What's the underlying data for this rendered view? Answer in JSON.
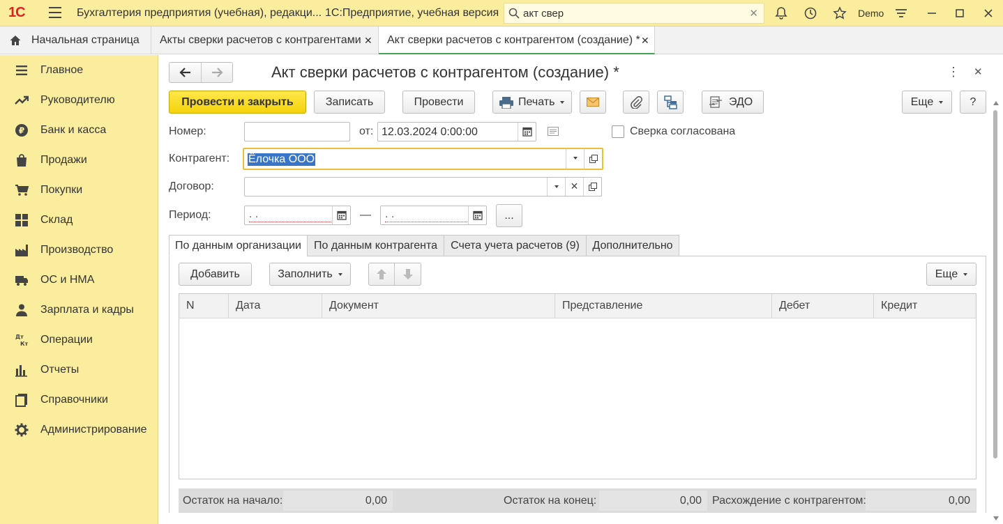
{
  "titlebar": {
    "logo": "1С",
    "app_title": "Бухгалтерия предприятия (учебная), редакци...",
    "platform": "1С:Предприятие, учебная версия",
    "search_value": "акт свер",
    "user": "Demo"
  },
  "tabs": [
    {
      "label": "Начальная страница"
    },
    {
      "label": "Акты сверки расчетов с контрагентами"
    },
    {
      "label": "Акт сверки расчетов с контрагентом (создание) *"
    }
  ],
  "sidebar": {
    "items": [
      {
        "label": "Главное",
        "icon": "menu-icon"
      },
      {
        "label": "Руководителю",
        "icon": "trend-icon"
      },
      {
        "label": "Банк и касса",
        "icon": "ruble-icon"
      },
      {
        "label": "Продажи",
        "icon": "bag-icon"
      },
      {
        "label": "Покупки",
        "icon": "cart-icon"
      },
      {
        "label": "Склад",
        "icon": "grid-icon"
      },
      {
        "label": "Производство",
        "icon": "factory-icon"
      },
      {
        "label": "ОС и НМА",
        "icon": "truck-icon"
      },
      {
        "label": "Зарплата и кадры",
        "icon": "person-icon"
      },
      {
        "label": "Операции",
        "icon": "dt-kt-icon"
      },
      {
        "label": "Отчеты",
        "icon": "bar-chart-icon"
      },
      {
        "label": "Справочники",
        "icon": "book-icon"
      },
      {
        "label": "Администрирование",
        "icon": "gear-icon"
      }
    ]
  },
  "form": {
    "title": "Акт сверки расчетов с контрагентом (создание) *",
    "toolbar": {
      "post_close": "Провести и закрыть",
      "save": "Записать",
      "post": "Провести",
      "print": "Печать",
      "edo": "ЭДО",
      "more": "Еще",
      "help": "?"
    },
    "number_label": "Номер:",
    "number_value": "",
    "from_label": "от:",
    "date_value": "12.03.2024  0:00:00",
    "agreed_label": "Сверка согласована",
    "counterparty_label": "Контрагент:",
    "counterparty_value": "Ёлочка ООО",
    "contract_label": "Договор:",
    "contract_value": "",
    "period_label": "Период:",
    "period_from": " .  .",
    "period_dash": "—",
    "period_to": " .  .",
    "period_btn": "..."
  },
  "subtabs": [
    {
      "label": "По данным организации"
    },
    {
      "label": "По данным контрагента"
    },
    {
      "label": "Счета учета расчетов (9)"
    },
    {
      "label": "Дополнительно"
    }
  ],
  "table_toolbar": {
    "add": "Добавить",
    "fill": "Заполнить",
    "more": "Еще"
  },
  "table": {
    "columns": [
      "N",
      "Дата",
      "Документ",
      "Представление",
      "Дебет",
      "Кредит"
    ],
    "rows": []
  },
  "footer": {
    "start_label": "Остаток на начало:",
    "start_value": "0,00",
    "end_label": "Остаток на конец:",
    "end_value": "0,00",
    "diff_label": "Расхождение с контрагентом:",
    "diff_value": "0,00"
  },
  "colors": {
    "sidebar_bg": "#fbed9e",
    "primary_button": "#f5d20a",
    "active_tab_accent": "#4aa35a",
    "focus_border": "#e8c33a"
  }
}
